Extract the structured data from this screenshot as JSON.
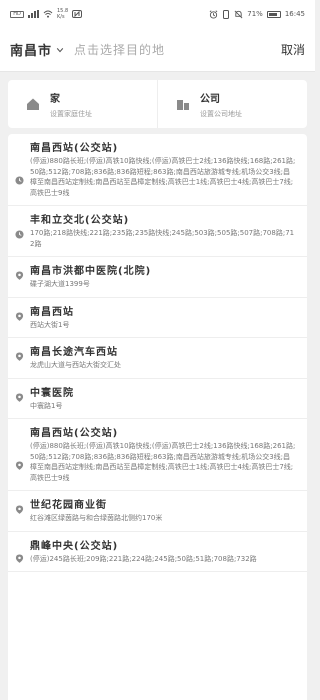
{
  "status_bar": {
    "speed": "15.8",
    "speed_unit": "K/s",
    "battery": "71%",
    "time": "16:45"
  },
  "search": {
    "city": "南昌市",
    "placeholder": "点击选择目的地",
    "cancel_label": "取消"
  },
  "favorites": [
    {
      "title": "家",
      "subtitle": "设置家庭住址",
      "icon": "home-icon"
    },
    {
      "title": "公司",
      "subtitle": "设置公司地址",
      "icon": "company-icon"
    }
  ],
  "results": [
    {
      "type": "history",
      "icon": "history-icon",
      "title": "南昌西站(公交站)",
      "detail": "(停运)880路长班;(停运)高铁10路快线;(停运)高铁巴士2线;136路快线;168路;261路;50路;512路;708路;836路;836路短程;863路;南昌西站旅游城专线;机场公交3线;昌樟至南昌西站定制线;南昌西站至昌樟定制线;高铁巴士1线;高铁巴士4线;高铁巴士7线;高铁巴士9线"
    },
    {
      "type": "history",
      "icon": "history-icon",
      "title": "丰和立交北(公交站)",
      "detail": "170路;218路快线;221路;235路;235路快线;245路;503路;505路;507路;708路;712路"
    },
    {
      "type": "place",
      "icon": "location-pin-icon",
      "title": "南昌市洪都中医院(北院)",
      "detail": "碟子湖大道1399号"
    },
    {
      "type": "place",
      "icon": "location-pin-icon",
      "title": "南昌西站",
      "detail": "西站大街1号"
    },
    {
      "type": "place",
      "icon": "location-pin-icon",
      "title": "南昌长途汽车西站",
      "detail": "龙虎山大道与西站大街交汇处"
    },
    {
      "type": "place",
      "icon": "location-pin-icon",
      "title": "中寰医院",
      "detail": "中寰路1号"
    },
    {
      "type": "place",
      "icon": "location-pin-icon",
      "title": "南昌西站(公交站)",
      "detail": "(停运)880路长班;(停运)高铁10路快线;(停运)高铁巴士2线;136路快线;168路;261路;50路;512路;708路;836路;836路短程;863路;南昌西站旅游城专线;机场公交3线;昌樟至南昌西站定制线;南昌西站至昌樟定制线;高铁巴士1线;高铁巴士4线;高铁巴士7线;高铁巴士9线"
    },
    {
      "type": "place",
      "icon": "location-pin-icon",
      "title": "世纪花园商业街",
      "detail": "红谷滩区绿茵路与和合绿茵路北侧约170米"
    },
    {
      "type": "place",
      "icon": "location-pin-icon",
      "title": "鼎峰中央(公交站)",
      "detail": "(停运)245路长班;209路;221路;224路;245路;50路;51路;708路;732路"
    }
  ]
}
